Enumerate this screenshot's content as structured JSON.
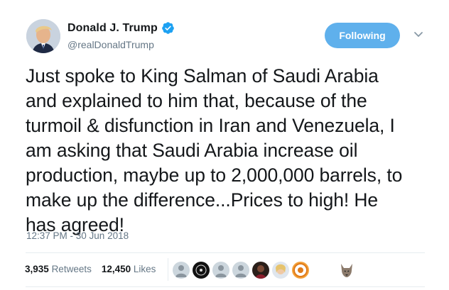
{
  "user": {
    "display_name": "Donald J. Trump",
    "handle": "@realDonaldTrump"
  },
  "follow_button": {
    "label": "Following"
  },
  "tweet": {
    "lines": [
      "Just spoke to King Salman of Saudi Arabia",
      "and explained to him that, because of the",
      "turmoil & disfunction in Iran and Venezuela, I",
      "am asking that Saudi Arabia increase oil",
      "production, maybe up to 2,000,000 barrels, to",
      "make up the difference...Prices to high! He",
      "has agreed!"
    ],
    "timestamp": "12:37 PM - 30 Jun 2018"
  },
  "stats": {
    "retweets_count": "3,935",
    "retweets_label": "Retweets",
    "likes_count": "12,450",
    "likes_label": "Likes"
  },
  "colors": {
    "follow_button": "#5fb0ec",
    "verified": "#1da1f2",
    "secondary_text": "#657786"
  }
}
